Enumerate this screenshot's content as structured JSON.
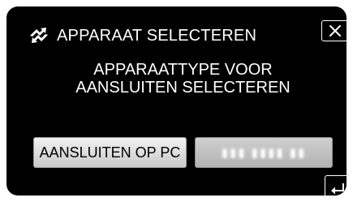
{
  "header": {
    "icon": "connection-arrows-icon",
    "title": "APPARAAT SELECTEREN",
    "close_icon": "close-icon"
  },
  "message": {
    "line1": "APPARAATTYPE VOOR",
    "line2": "AANSLUITEN SELECTEREN"
  },
  "buttons": {
    "connect_pc_label": "AANSLUITEN OP PC",
    "blurred_label": "▮▮▮ ▮▮▮▮ ▮▮"
  },
  "footer": {
    "back_icon": "return-arrow-icon"
  },
  "colors": {
    "background": "#000000",
    "text": "#ffffff",
    "button_face": "#e0e0e0"
  }
}
